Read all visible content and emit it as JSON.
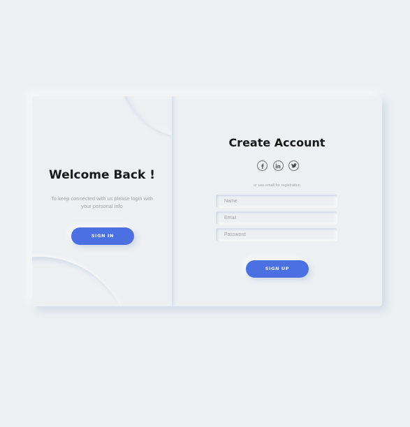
{
  "signin_panel": {
    "title": "Welcome Back !",
    "description": "To keep connected with us please login with your personal info",
    "button_label": "SIGN IN"
  },
  "signup_panel": {
    "title": "Create Account",
    "social_icons": [
      "facebook-icon",
      "linkedin-icon",
      "twitter-icon"
    ],
    "note": "or use email for registration",
    "fields": {
      "name_placeholder": "Name",
      "email_placeholder": "Email",
      "password_placeholder": "Password"
    },
    "button_label": "SIGN UP"
  },
  "colors": {
    "background": "#ecf0f3",
    "accent": "#4b70e2",
    "title_text": "#181818",
    "muted_text": "#a0a5a8"
  }
}
